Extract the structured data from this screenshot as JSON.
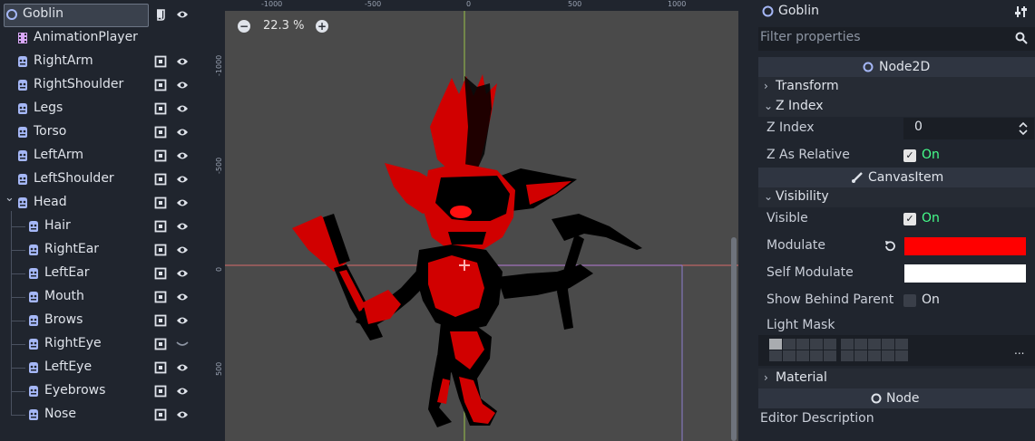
{
  "scene_tree": {
    "nodes": [
      {
        "label": "Goblin",
        "type": "node2d",
        "depth": 0,
        "selected": true,
        "has_script": true
      },
      {
        "label": "AnimationPlayer",
        "type": "animation",
        "depth": 1
      },
      {
        "label": "RightArm",
        "type": "sprite",
        "depth": 1
      },
      {
        "label": "RightShoulder",
        "type": "sprite",
        "depth": 1
      },
      {
        "label": "Legs",
        "type": "sprite",
        "depth": 1
      },
      {
        "label": "Torso",
        "type": "sprite",
        "depth": 1
      },
      {
        "label": "LeftArm",
        "type": "sprite",
        "depth": 1
      },
      {
        "label": "LeftShoulder",
        "type": "sprite",
        "depth": 1
      },
      {
        "label": "Head",
        "type": "sprite",
        "depth": 1,
        "expanded": true
      },
      {
        "label": "Hair",
        "type": "sprite",
        "depth": 2
      },
      {
        "label": "RightEar",
        "type": "sprite",
        "depth": 2
      },
      {
        "label": "LeftEar",
        "type": "sprite",
        "depth": 2
      },
      {
        "label": "Mouth",
        "type": "sprite",
        "depth": 2
      },
      {
        "label": "Brows",
        "type": "sprite",
        "depth": 2
      },
      {
        "label": "RightEye",
        "type": "sprite",
        "depth": 2,
        "hidden": true
      },
      {
        "label": "LeftEye",
        "type": "sprite",
        "depth": 2
      },
      {
        "label": "Eyebrows",
        "type": "sprite",
        "depth": 2
      },
      {
        "label": "Nose",
        "type": "sprite",
        "depth": 2
      }
    ]
  },
  "viewport": {
    "zoom": "22.3 %",
    "ruler_top": [
      "-1000",
      "-500",
      "0",
      "500",
      "1000"
    ],
    "ruler_left": [
      "-1000",
      "-500",
      "0",
      "500"
    ]
  },
  "inspector": {
    "node_name": "Goblin",
    "filter_placeholder": "Filter properties",
    "node2d_header": "Node2D",
    "transform_group": "Transform",
    "zindex_group": "Z Index",
    "z_index_label": "Z Index",
    "z_index_value": "0",
    "z_as_relative_label": "Z As Relative",
    "z_as_relative_value": "On",
    "canvasitem_header": "CanvasItem",
    "visibility_group": "Visibility",
    "visible_label": "Visible",
    "visible_value": "On",
    "modulate_label": "Modulate",
    "modulate_color": "#ff0000",
    "self_modulate_label": "Self Modulate",
    "self_modulate_color": "#ffffff",
    "show_behind_parent_label": "Show Behind Parent",
    "show_behind_parent_value": "On",
    "light_mask_label": "Light Mask",
    "light_mask_more": "...",
    "material_group": "Material",
    "node_header": "Node",
    "editor_description_label": "Editor Description"
  },
  "colors": {
    "accent_green": "#45ff8b",
    "node_icon": "#a5b7f6",
    "sprite_tint": "#e00000"
  }
}
